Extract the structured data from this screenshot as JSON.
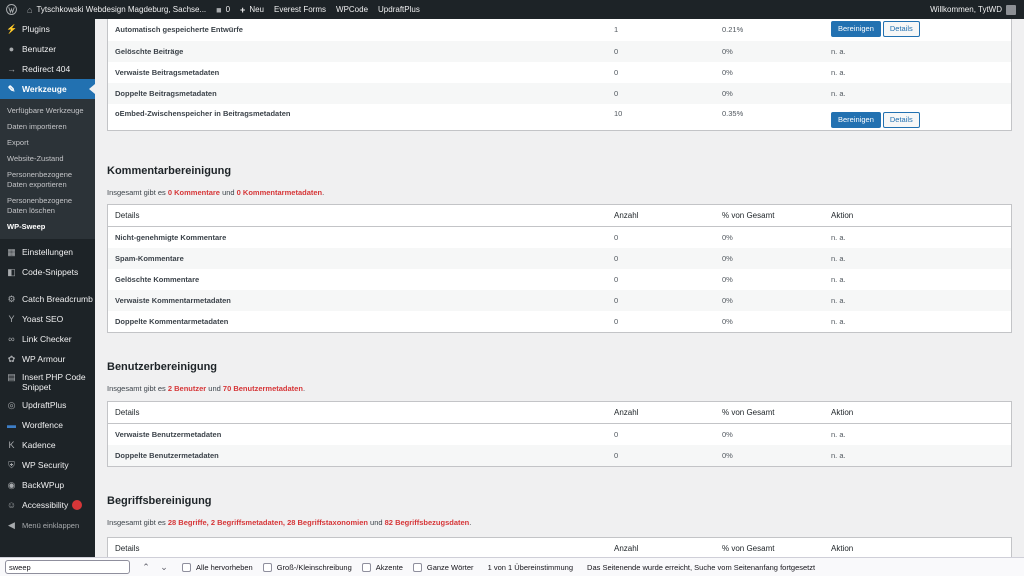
{
  "adminbar": {
    "site_name": "Tytschkowski Webdesign Magdeburg, Sachse...",
    "comments_count": "0",
    "new_label": "Neu",
    "links": [
      "Everest Forms",
      "WPCode",
      "UpdraftPlus"
    ],
    "greeting": "Willkommen, TytWD"
  },
  "sidebar": {
    "items_top": [
      {
        "label": "Plugins",
        "icon": "plug-icon"
      },
      {
        "label": "Benutzer",
        "icon": "user-icon"
      },
      {
        "label": "Redirect 404",
        "icon": "redirect-arrow-icon"
      }
    ],
    "active": {
      "label": "Werkzeuge",
      "icon": "wrench-icon"
    },
    "submenu": [
      "Verfügbare Werkzeuge",
      "Daten importieren",
      "Export",
      "Website-Zustand",
      "Personenbezogene Daten exportieren",
      "Personenbezogene Daten löschen",
      "WP-Sweep"
    ],
    "items_bottom": [
      {
        "label": "Einstellungen",
        "icon": "settings-icon"
      },
      {
        "label": "Code-Snippets",
        "icon": "code-icon"
      },
      {
        "label": "Catch Breadcrumb",
        "icon": "breadcrumb-icon"
      },
      {
        "label": "Yoast SEO",
        "icon": "yoast-icon"
      },
      {
        "label": "Link Checker",
        "icon": "link-icon"
      },
      {
        "label": "WP Armour",
        "icon": "armour-icon"
      },
      {
        "label": "Insert PHP Code Snippet",
        "icon": "php-icon"
      },
      {
        "label": "UpdraftPlus",
        "icon": "updraft-icon"
      },
      {
        "label": "Wordfence",
        "icon": "wordfence-icon"
      },
      {
        "label": "Kadence",
        "icon": "kadence-icon"
      },
      {
        "label": "WP Security",
        "icon": "shield-icon"
      },
      {
        "label": "BackWPup",
        "icon": "backup-icon"
      },
      {
        "label": "Accessibility",
        "icon": "accessibility-icon"
      },
      {
        "label": "Menü einklappen",
        "icon": "collapse-icon"
      }
    ]
  },
  "common": {
    "headers": [
      "Details",
      "Anzahl",
      "% von Gesamt",
      "Aktion"
    ],
    "na": "n. a.",
    "btn_clean": "Bereinigen",
    "btn_details": "Details"
  },
  "posts_table": {
    "rows": [
      {
        "label": "Automatisch gespeicherte Entwürfe",
        "count": "1",
        "pct": "0.21%",
        "action": "buttons"
      },
      {
        "label": "Gelöschte Beiträge",
        "count": "0",
        "pct": "0%",
        "action": "n. a."
      },
      {
        "label": "Verwaiste Beitragsmetadaten",
        "count": "0",
        "pct": "0%",
        "action": "n. a."
      },
      {
        "label": "Doppelte Beitragsmetadaten",
        "count": "0",
        "pct": "0%",
        "action": "n. a."
      },
      {
        "label": "oEmbed-Zwischenspeicher in Beitragsmetadaten",
        "count": "10",
        "pct": "0.35%",
        "action": "buttons"
      }
    ]
  },
  "comments_section": {
    "title": "Kommentarbereinigung",
    "summary": {
      "pre": "Insgesamt gibt es ",
      "a": "0 Kommentare",
      "mid": " und ",
      "b": "0 Kommentarmetadaten",
      "post": "."
    },
    "rows": [
      {
        "label": "Nicht-genehmigte Kommentare",
        "count": "0",
        "pct": "0%"
      },
      {
        "label": "Spam-Kommentare",
        "count": "0",
        "pct": "0%"
      },
      {
        "label": "Gelöschte Kommentare",
        "count": "0",
        "pct": "0%"
      },
      {
        "label": "Verwaiste Kommentarmetadaten",
        "count": "0",
        "pct": "0%"
      },
      {
        "label": "Doppelte Kommentarmetadaten",
        "count": "0",
        "pct": "0%"
      }
    ]
  },
  "users_section": {
    "title": "Benutzerbereinigung",
    "summary": {
      "pre": "Insgesamt gibt es ",
      "a": "2 Benutzer",
      "mid": " und ",
      "b": "70 Benutzermetadaten",
      "post": "."
    },
    "rows": [
      {
        "label": "Verwaiste Benutzermetadaten",
        "count": "0",
        "pct": "0%"
      },
      {
        "label": "Doppelte Benutzermetadaten",
        "count": "0",
        "pct": "0%"
      }
    ]
  },
  "terms_section": {
    "title": "Begriffsbereinigung",
    "summary": {
      "pre": "Insgesamt gibt es ",
      "a": "28 Begriffe",
      "s1": ", ",
      "b": "2 Begriffsmetadaten",
      "s2": ", ",
      "c": "28 Begriffstaxonomien",
      "s3": " und ",
      "d": "82 Begriffsbezugsdaten",
      "post": "."
    }
  },
  "findbar": {
    "query": "sweep",
    "options": [
      {
        "label": "Alle hervorheben"
      },
      {
        "label": "Groß-/Kleinschreibung"
      },
      {
        "label": "Akzente"
      },
      {
        "label": "Ganze Wörter"
      }
    ],
    "match_count": "1 von 1 Übereinstimmung",
    "status": "Das Seitenende wurde erreicht, Suche vom Seitenanfang fortgesetzt"
  },
  "colors": {
    "accent": "#2271b1",
    "highlight": "#d63638",
    "sidebar_bg": "#1d2327"
  }
}
